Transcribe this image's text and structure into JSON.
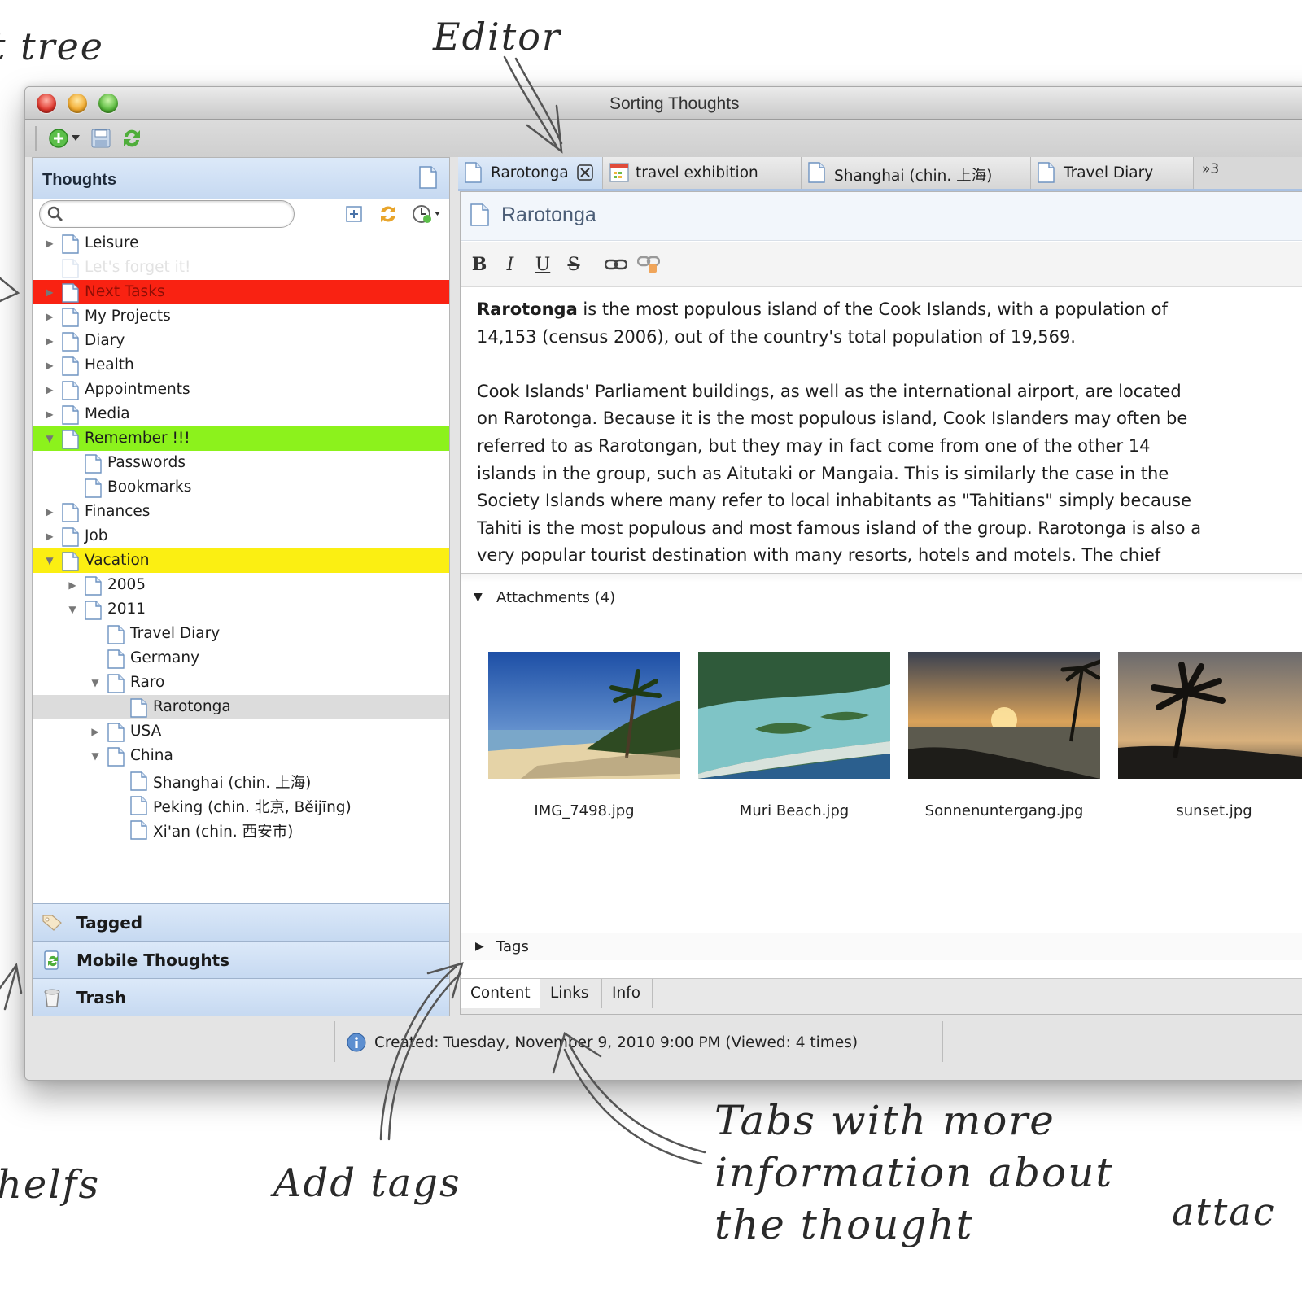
{
  "annotations": {
    "thought_tree": "t tree",
    "editor": "Editor",
    "shelfs": "helfs",
    "add_tags": "Add tags",
    "tabs_info_line1": "Tabs with more",
    "tabs_info_line2": "information about",
    "tabs_info_line3": "the thought",
    "attach": "attac"
  },
  "window": {
    "title": "Sorting Thoughts"
  },
  "toolbar": {
    "icons": [
      "add-icon",
      "dropdown-arrow-icon",
      "save-icon",
      "sync-icon"
    ]
  },
  "left_pane": {
    "title": "Thoughts",
    "search": {
      "value": "",
      "placeholder": ""
    },
    "tree": [
      {
        "label": "Leisure"
      },
      {
        "label": "Let's forget it!"
      },
      {
        "label": "Next Tasks"
      },
      {
        "label": "My Projects"
      },
      {
        "label": "Diary"
      },
      {
        "label": "Health"
      },
      {
        "label": "Appointments"
      },
      {
        "label": "Media"
      },
      {
        "label": "Remember !!!"
      },
      {
        "label": "Passwords"
      },
      {
        "label": "Bookmarks"
      },
      {
        "label": "Finances"
      },
      {
        "label": "Job"
      },
      {
        "label": "Vacation"
      },
      {
        "label": "2005"
      },
      {
        "label": "2011"
      },
      {
        "label": "Travel Diary"
      },
      {
        "label": "Germany"
      },
      {
        "label": "Raro"
      },
      {
        "label": "Rarotonga"
      },
      {
        "label": "USA"
      },
      {
        "label": "China"
      },
      {
        "label": "Shanghai (chin. 上海)"
      },
      {
        "label": "Peking (chin. 北京, Běijīng)"
      },
      {
        "label": "Xi'an (chin. 西安市)"
      }
    ],
    "shelves": [
      {
        "label": "Tagged",
        "icon": "tag-icon"
      },
      {
        "label": "Mobile Thoughts",
        "icon": "mobile-sync-icon"
      },
      {
        "label": "Trash",
        "icon": "trash-icon"
      }
    ],
    "colors": {
      "red": "#f92212",
      "green": "#8cf21c",
      "yellow": "#fbef12",
      "accent": "#c6d9f1"
    }
  },
  "tabs": [
    {
      "label": "Rarotonga"
    },
    {
      "label": "travel exhibition"
    },
    {
      "label": "Shanghai (chin. 上海)"
    },
    {
      "label": "Travel Diary"
    }
  ],
  "tabs_overflow": "»3",
  "editor": {
    "title": "Rarotonga",
    "format_buttons": {
      "bold": "B",
      "italic": "I",
      "underline": "U",
      "strike": "S"
    },
    "paragraph1_bold": "Rarotonga",
    "paragraph1_line1": " is the most populous island of the Cook Islands, with a population of",
    "paragraph1_line2": "14,153 (census 2006), out of the country's total population of 19,569.",
    "paragraph2_lines": [
      "Cook Islands' Parliament buildings, as well as the international airport, are located",
      "on Rarotonga. Because it is the most populous island, Cook Islanders may often be",
      "referred to as Rarotongan, but they may in fact come from one of the other 14",
      "islands in the group, such as Aitutaki or Mangaia. This is similarly the case in the",
      "Society Islands where many refer to local inhabitants as \"Tahitians\" simply because",
      "Tahiti is the most populous and most famous island of the group. Rarotonga is also a",
      "very popular tourist destination with many resorts, hotels and motels. The chief"
    ]
  },
  "attachments": {
    "header": "Attachments (4)",
    "items": [
      {
        "name": "IMG_7498.jpg"
      },
      {
        "name": "Muri Beach.jpg"
      },
      {
        "name": "Sonnenuntergang.jpg"
      },
      {
        "name": "sunset.jpg"
      }
    ]
  },
  "tags": {
    "header": "Tags"
  },
  "bottom_tabs": [
    {
      "label": "Content"
    },
    {
      "label": "Links"
    },
    {
      "label": "Info"
    }
  ],
  "status": {
    "text": "Created: Tuesday, November 9, 2010 9:00 PM  (Viewed: 4 times)"
  }
}
